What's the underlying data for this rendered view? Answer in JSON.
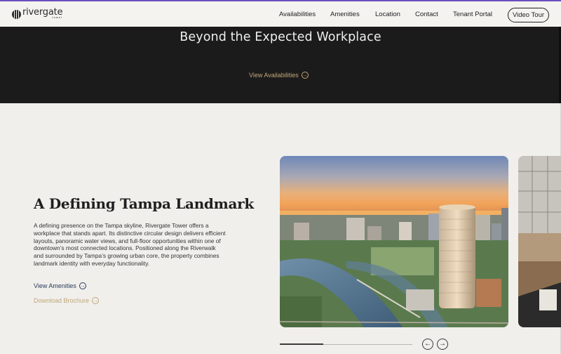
{
  "brand": {
    "name": "rivergate",
    "sub": "tower"
  },
  "nav": {
    "items": [
      {
        "label": "Availabilities"
      },
      {
        "label": "Amenities"
      },
      {
        "label": "Location"
      },
      {
        "label": "Contact"
      },
      {
        "label": "Tenant Portal"
      }
    ],
    "cta_label": "Video Tour"
  },
  "hero": {
    "title": "Beyond the Expected Workplace",
    "link_label": "View Availabilities",
    "link_icon": "arrow-right-circle-icon"
  },
  "section": {
    "title": "A Defining Tampa Landmark",
    "body": "A defining presence on the Tampa skyline, Rivergate Tower offers a workplace that stands apart. Its distinctive circular design delivers efficient layouts, panoramic water views, and full-floor opportunities within one of downtown’s most connected locations. Positioned along the Riverwalk and surrounded by Tampa’s growing urban core, the property combines landmark identity with everyday functionality.",
    "link_amenities": "View Amenities",
    "link_brochure": "Download Brochure"
  },
  "carousel": {
    "progress": 0.33,
    "prev_icon": "arrow-left-circle-icon",
    "next_icon": "arrow-right-circle-icon"
  },
  "colors": {
    "accent_gold": "#c0a776",
    "link_navy": "#2a3b57",
    "hero_bg": "#1c1b1b",
    "page_bg": "#f0efec"
  }
}
